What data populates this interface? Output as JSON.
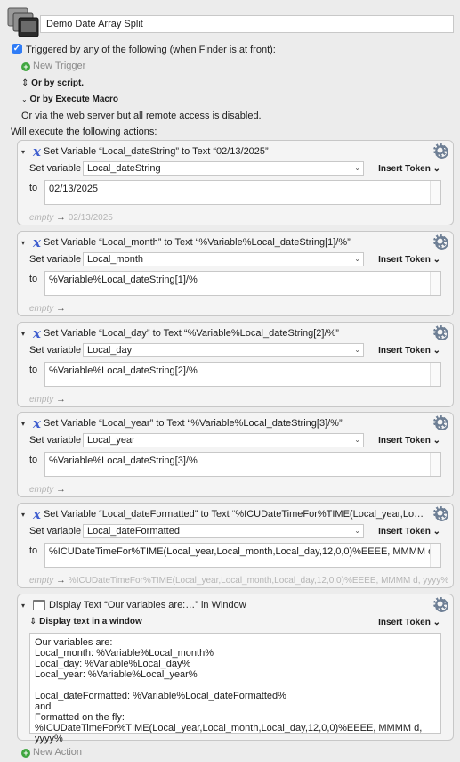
{
  "macro": {
    "name": "Demo Date Array Split"
  },
  "trigger": {
    "header": "Triggered by any of the following (when Finder is at front):",
    "new_trigger": "New Trigger",
    "or_by_script": "Or by script.",
    "or_by_execute": "Or by Execute Macro",
    "web_server": "Or via the web server but all remote access is disabled."
  },
  "will_execute": "Will execute the following actions:",
  "common": {
    "set_variable": "Set variable",
    "to": "to",
    "insert_token": "Insert Token ⌄",
    "empty": "empty",
    "arrow": "→"
  },
  "actions": [
    {
      "title": "Set Variable “Local_dateString” to Text “02/13/2025”",
      "variable": "Local_dateString",
      "text": "02/13/2025",
      "result": "02/13/2025"
    },
    {
      "title": "Set Variable “Local_month” to Text “%Variable%Local_dateString[1]/%”",
      "variable": "Local_month",
      "text": "%Variable%Local_dateString[1]/%",
      "result": ""
    },
    {
      "title": "Set Variable “Local_day” to Text “%Variable%Local_dateString[2]/%”",
      "variable": "Local_day",
      "text": "%Variable%Local_dateString[2]/%",
      "result": ""
    },
    {
      "title": "Set Variable “Local_year” to Text “%Variable%Local_dateString[3]/%”",
      "variable": "Local_year",
      "text": "%Variable%Local_dateString[3]/%",
      "result": ""
    },
    {
      "title": "Set Variable “Local_dateFormatted” to Text “%ICUDateTimeFor%TIME(Local_year,Local_month...",
      "variable": "Local_dateFormatted",
      "text": "%ICUDateTimeFor%TIME(Local_year,Local_month,Local_day,12,0,0)%EEEE, MMMM d, yyyy%",
      "result": "%ICUDateTimeFor%TIME(Local_year,Local_month,Local_day,12,0,0)%EEEE, MMMM d, yyyy%"
    }
  ],
  "display": {
    "title": "Display Text “Our variables are:…” in Window",
    "mode": "Display text in a window",
    "body": "Our variables are:\nLocal_month: %Variable%Local_month%\nLocal_day: %Variable%Local_day%\nLocal_year: %Variable%Local_year%\n\nLocal_dateFormatted: %Variable%Local_dateFormatted%\nand\nFormatted on the fly: %ICUDateTimeFor%TIME(Local_year,Local_month,Local_day,12,0,0)%EEEE, MMMM d, yyyy%"
  },
  "new_action": "New Action"
}
